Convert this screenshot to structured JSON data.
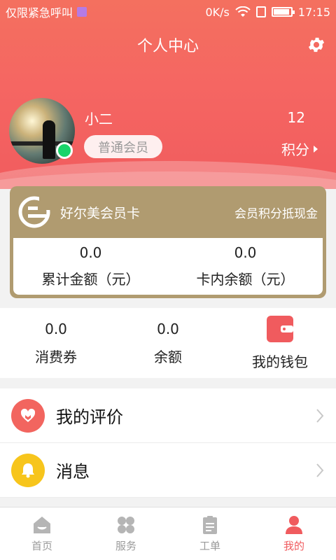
{
  "status_bar": {
    "carrier": "仅限紧急呼叫",
    "network_speed": "0K/s",
    "time": "17:15"
  },
  "header": {
    "title": "个人中心"
  },
  "profile": {
    "username": "小二",
    "member_level": "普通会员",
    "points_value": "12",
    "points_label": "积分"
  },
  "member_card": {
    "name": "好尔美会员卡",
    "subtitle": "会员积分抵现金",
    "stats": [
      {
        "value": "0.0",
        "label": "累计金额（元）"
      },
      {
        "value": "0.0",
        "label": "卡内余额（元）"
      }
    ]
  },
  "wallet": {
    "coupons": {
      "value": "0.0",
      "label": "消费券"
    },
    "balance": {
      "value": "0.0",
      "label": "余额"
    },
    "my_wallet_label": "我的钱包"
  },
  "menu": [
    {
      "label": "我的评价",
      "icon": "heart-icon",
      "color": "#f2655f"
    },
    {
      "label": "消息",
      "icon": "bell-icon",
      "color": "#f7c51c"
    }
  ],
  "tabs": [
    {
      "label": "首页",
      "icon": "home-icon",
      "active": false
    },
    {
      "label": "服务",
      "icon": "grid-icon",
      "active": false
    },
    {
      "label": "工单",
      "icon": "clipboard-icon",
      "active": false
    },
    {
      "label": "我的",
      "icon": "person-icon",
      "active": true
    }
  ],
  "colors": {
    "accent": "#f05b5e",
    "card_gold": "#b09b70",
    "online": "#19d46a"
  }
}
